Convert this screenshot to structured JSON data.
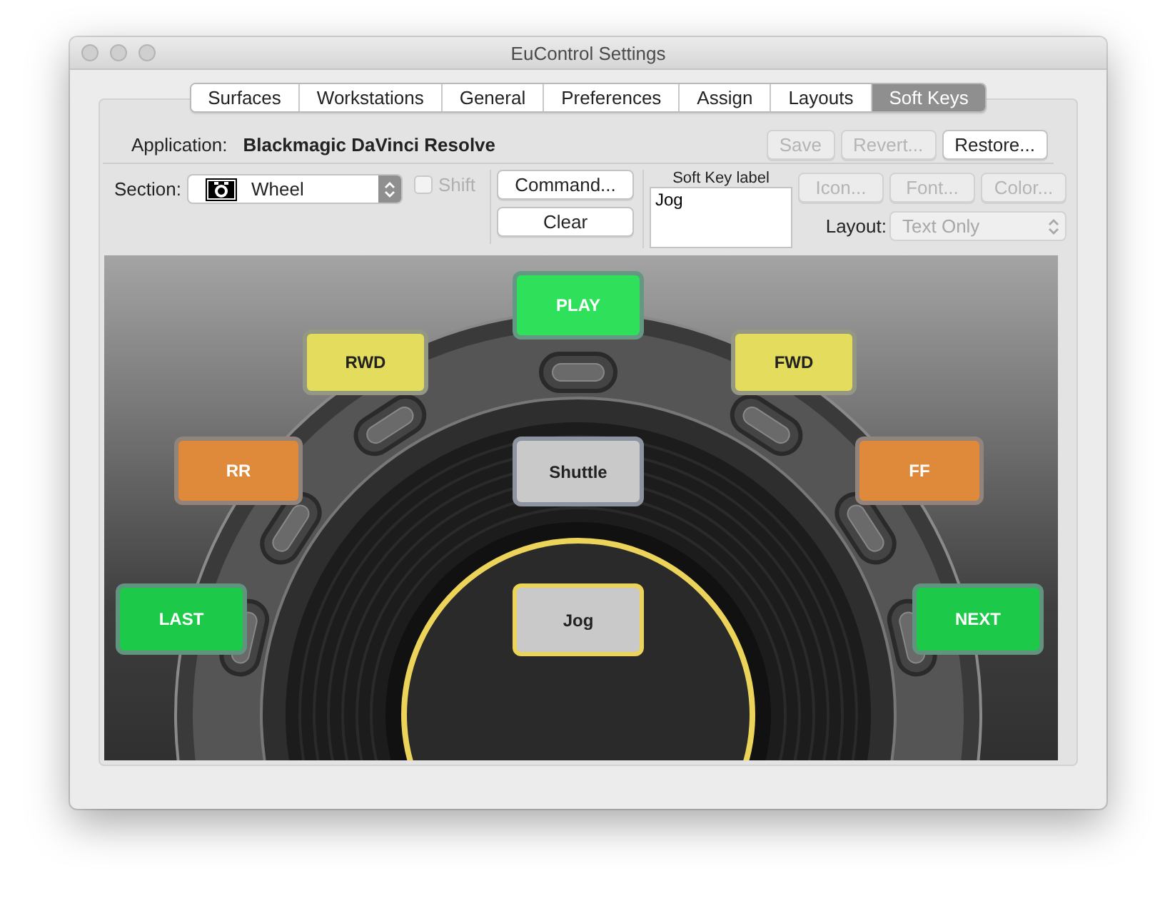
{
  "window": {
    "title": "EuControl Settings"
  },
  "tabs": [
    {
      "label": "Surfaces",
      "selected": false
    },
    {
      "label": "Workstations",
      "selected": false
    },
    {
      "label": "General",
      "selected": false
    },
    {
      "label": "Preferences",
      "selected": false
    },
    {
      "label": "Assign",
      "selected": false
    },
    {
      "label": "Layouts",
      "selected": false
    },
    {
      "label": "Soft Keys",
      "selected": true
    }
  ],
  "application": {
    "label": "Application:",
    "value": "Blackmagic DaVinci Resolve"
  },
  "file_buttons": [
    {
      "label": "Save",
      "disabled": true
    },
    {
      "label": "Revert...",
      "disabled": true
    },
    {
      "label": "Restore...",
      "disabled": false
    }
  ],
  "section": {
    "label": "Section:",
    "value": "Wheel"
  },
  "shift": {
    "label": "Shift",
    "checked": false,
    "disabled": true
  },
  "command_buttons": [
    {
      "label": "Command...",
      "disabled": false
    },
    {
      "label": "Clear",
      "disabled": false
    }
  ],
  "soft_key_label": {
    "label": "Soft Key label",
    "value": "Jog"
  },
  "style_buttons": [
    {
      "label": "Icon...",
      "disabled": true
    },
    {
      "label": "Font...",
      "disabled": true
    },
    {
      "label": "Color...",
      "disabled": true
    }
  ],
  "layout": {
    "label": "Layout:",
    "value": "Text Only",
    "disabled": true
  },
  "keys": [
    {
      "label": "PLAY",
      "color": "#2fe05a",
      "selected": false
    },
    {
      "label": "RWD",
      "color": "#e3dc5c",
      "selected": false
    },
    {
      "label": "FWD",
      "color": "#e3dc5c",
      "selected": false
    },
    {
      "label": "RR",
      "color": "#df8a3a",
      "selected": false
    },
    {
      "label": "Shuttle",
      "color": "#c9c9c9",
      "selected": false
    },
    {
      "label": "FF",
      "color": "#df8a3a",
      "selected": false
    },
    {
      "label": "LAST",
      "color": "#1cc948",
      "selected": false
    },
    {
      "label": "Jog",
      "color": "#c9c9c9",
      "selected": true
    },
    {
      "label": "NEXT",
      "color": "#1cc948",
      "selected": false
    }
  ]
}
